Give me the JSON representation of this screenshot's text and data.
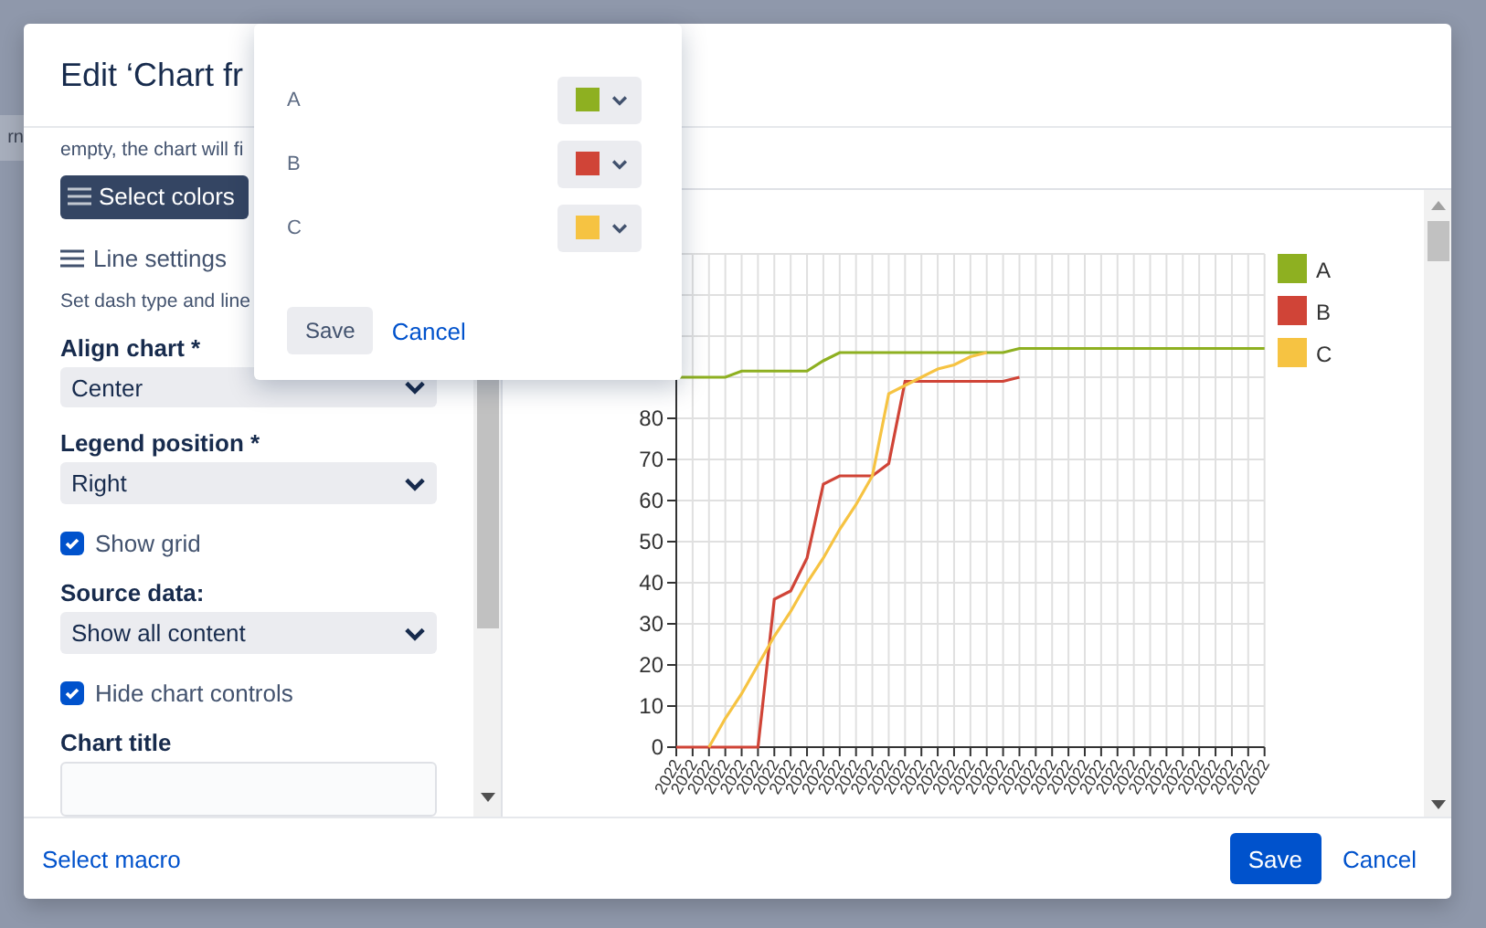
{
  "background_page": {
    "text": "rn"
  },
  "dialog": {
    "title": "Edit ‘Chart fr",
    "description": "empty, the chart will fi",
    "select_colors_button": "Select colors",
    "line_settings_link": "Line settings",
    "line_settings_hint": "Set dash type and line",
    "fields": [
      {
        "kind": "select",
        "label": "Align chart *",
        "value": "Center"
      },
      {
        "kind": "select",
        "label": "Legend position *",
        "value": "Right"
      },
      {
        "kind": "checkbox",
        "label": "Show grid",
        "checked": true
      },
      {
        "kind": "select",
        "label": "Source data:",
        "value": "Show all content"
      },
      {
        "kind": "checkbox",
        "label": "Hide chart controls",
        "checked": true
      },
      {
        "kind": "text",
        "label": "Chart title"
      }
    ],
    "chart_data": {
      "type": "line",
      "grid": true,
      "legend": true,
      "ylim": [
        0,
        120
      ],
      "yticks": [
        0,
        10,
        20,
        30,
        40,
        50,
        60,
        70,
        80
      ],
      "categories": [
        "2022",
        "2022",
        "2022",
        "2022",
        "2022",
        "2022",
        "2022",
        "2022",
        "2022",
        "2022",
        "2022",
        "2022",
        "2022",
        "2022",
        "2022",
        "2022",
        "2022",
        "2022",
        "2022",
        "2022",
        "2022",
        "2022",
        "2022",
        "2022",
        "2022",
        "2022",
        "2022",
        "2022",
        "2022",
        "2022",
        "2022",
        "2022",
        "2022",
        "2022",
        "2022",
        "2022",
        "2022"
      ],
      "series": [
        {
          "name": "A",
          "color": "#8eb021",
          "values": [
            90,
            90,
            90,
            90,
            91.5,
            91.5,
            91.5,
            91.5,
            91.5,
            94,
            96,
            96,
            96,
            96,
            96,
            96,
            96,
            96,
            96,
            96,
            96,
            97,
            97,
            97,
            97,
            97,
            97,
            97,
            97,
            97,
            97,
            97,
            97,
            97,
            97,
            97,
            97
          ]
        },
        {
          "name": "B",
          "color": "#d04437",
          "values": [
            0,
            0,
            0,
            0,
            0,
            0,
            36,
            38,
            46,
            64,
            66,
            66,
            66,
            69,
            89,
            89,
            89,
            89,
            89,
            89,
            89,
            90,
            null,
            null,
            null,
            null,
            null,
            null,
            null,
            null,
            null,
            null,
            null,
            null,
            null,
            null,
            null
          ]
        },
        {
          "name": "C",
          "color": "#f6c342",
          "values": [
            null,
            null,
            0,
            7,
            13,
            20,
            27,
            33,
            40,
            46,
            53,
            59,
            66,
            86,
            88,
            90,
            92,
            93,
            95,
            96,
            null,
            null,
            null,
            null,
            null,
            null,
            null,
            null,
            null,
            null,
            null,
            null,
            null,
            null,
            null,
            null,
            null
          ]
        }
      ]
    },
    "footer": {
      "link": "Select macro",
      "save": "Save",
      "cancel": "Cancel"
    }
  },
  "color_popover": {
    "rows": [
      {
        "label": "A",
        "color": "#8eb021"
      },
      {
        "label": "B",
        "color": "#d04437"
      },
      {
        "label": "C",
        "color": "#f6c342"
      }
    ],
    "save": "Save",
    "cancel": "Cancel"
  }
}
